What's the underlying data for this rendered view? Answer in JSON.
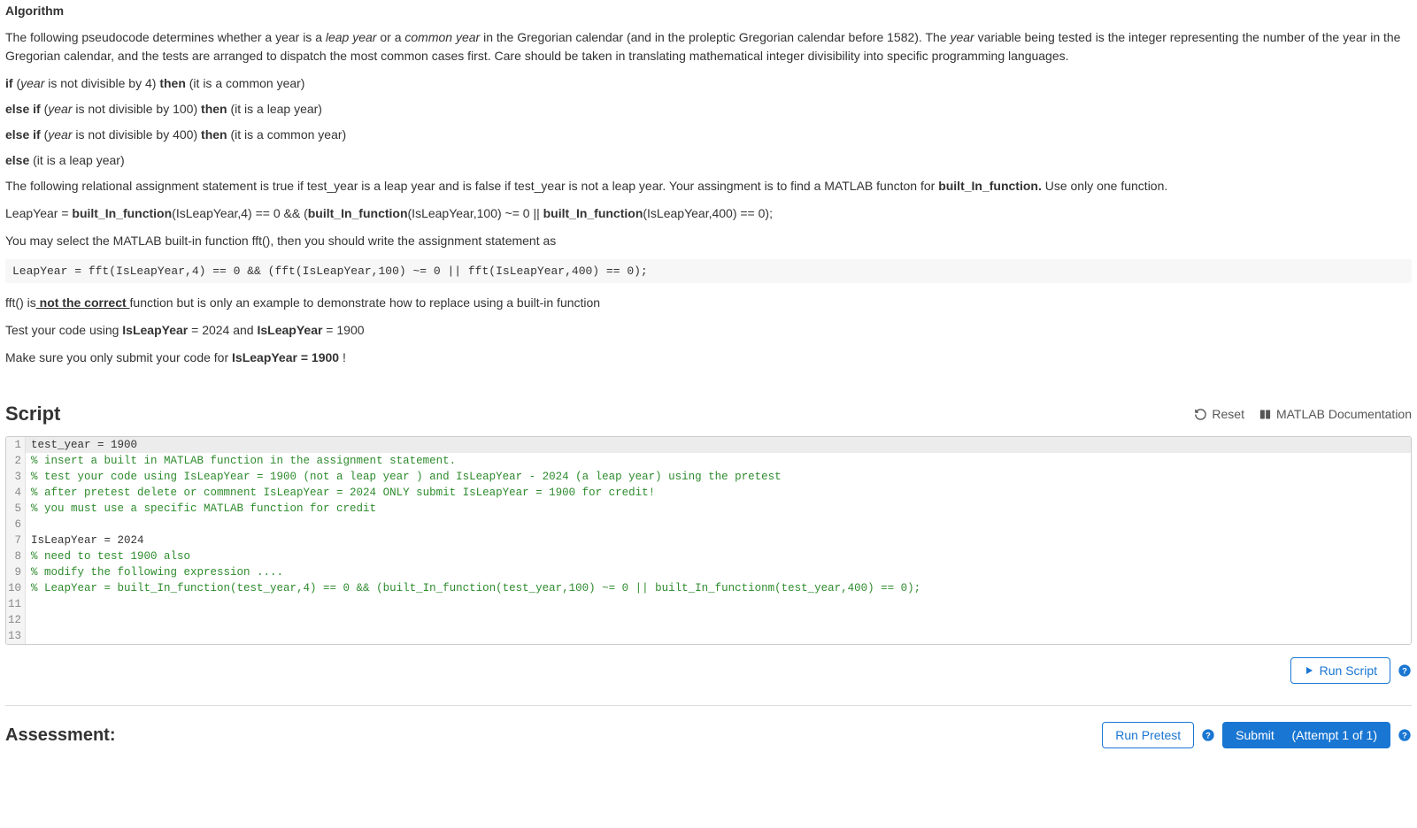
{
  "algorithm": {
    "heading": "Algorithm",
    "intro_pre": "The following pseudocode determines whether a year is a ",
    "leap_italic": "leap year",
    "intro_mid1": " or a ",
    "common_italic": "common year",
    "intro_mid2": " in the Gregorian calendar (and in the proleptic Gregorian calendar before 1582). The ",
    "year_italic": "year",
    "intro_post": " variable being tested is the integer representing the number of the year in the Gregorian calendar, and the tests are arranged to dispatch the most common cases first. Care should be taken in translating mathematical integer divisibility into specific programming languages.",
    "pseudo": {
      "l1_if": "if",
      "l1_open": " (",
      "l1_year": "year",
      "l1_cond": " is not divisible by 4) ",
      "l1_then": "then",
      "l1_result": " (it is a common year)",
      "l2_elseif": "else if",
      "l2_open": " (",
      "l2_year": "year",
      "l2_cond": " is not divisible by 100) ",
      "l2_then": "then",
      "l2_result": " (it is a leap year)",
      "l3_elseif": "else if",
      "l3_open": " (",
      "l3_year": "year",
      "l3_cond": " is not divisible by 400) ",
      "l3_then": "then",
      "l3_result": " (it is a common year)",
      "l4_else": "else",
      "l4_result": " (it is a leap year)"
    },
    "para2_pre": "The following relational assignment statement is true if test_year is a leap year and is false if test_year is not a leap year.  Your assingment is to find a MATLAB functon for ",
    "para2_bold": "built_In_function.",
    "para2_post": "  Use only one function.",
    "stmt_pre": "LeapYear = ",
    "stmt_b1": "built_In_function",
    "stmt_m1": "(IsLeapYear,4) == 0 && (",
    "stmt_b2": "built_In_function",
    "stmt_m2": "(IsLeapYear,100) ~= 0 || ",
    "stmt_b3": "built_In_function",
    "stmt_m3": "(IsLeapYear,400) == 0);",
    "para3": "You may select the MATLAB built-in function fft(), then you should write the assignment statement as",
    "code_fft": "LeapYear = fft(IsLeapYear,4) == 0 && (fft(IsLeapYear,100) ~= 0 || fft(IsLeapYear,400) == 0);",
    "para4_pre": "fft() is",
    "para4_under": " not the correct ",
    "para4_post": "function but is only an example to demonstrate how to replace using a built-in function",
    "para5_pre": "Test your code using ",
    "para5_b1": "IsLeapYear",
    "para5_m1": " = 2024 and ",
    "para5_b2": "IsLeapYear",
    "para5_m2": " = 1900",
    "para6_pre": "Make sure you only submit your code for ",
    "para6_bold": "IsLeapYear = 1900",
    "para6_post": " !"
  },
  "script": {
    "title": "Script",
    "reset_label": "Reset",
    "docs_label": "MATLAB Documentation",
    "lines": [
      {
        "n": "1",
        "active": true,
        "plain": "test_year = 1900",
        "comment": ""
      },
      {
        "n": "2",
        "active": false,
        "plain": "",
        "comment": "% insert a built in MATLAB function in the assignment statement."
      },
      {
        "n": "3",
        "active": false,
        "plain": "",
        "comment": "% test your code using IsLeapYear = 1900 (not a leap year ) and IsLeapYear - 2024 (a leap year) using the pretest"
      },
      {
        "n": "4",
        "active": false,
        "plain": "",
        "comment": "% after pretest delete or commnent IsLeapYear = 2024 ONLY submit IsLeapYear = 1900 for credit!"
      },
      {
        "n": "5",
        "active": false,
        "plain": "",
        "comment": "% you must use a specific MATLAB function for credit"
      },
      {
        "n": "6",
        "active": false,
        "plain": "",
        "comment": ""
      },
      {
        "n": "7",
        "active": false,
        "plain": "IsLeapYear = 2024",
        "comment": ""
      },
      {
        "n": "8",
        "active": false,
        "plain": "",
        "comment": "% need to test 1900 also"
      },
      {
        "n": "9",
        "active": false,
        "plain": "",
        "comment": "% modify the following expression ...."
      },
      {
        "n": "10",
        "active": false,
        "plain": "",
        "comment": "% LeapYear = built_In_function(test_year,4) == 0 && (built_In_function(test_year,100) ~= 0 || built_In_functionm(test_year,400) == 0);"
      },
      {
        "n": "11",
        "active": false,
        "plain": "",
        "comment": ""
      },
      {
        "n": "12",
        "active": false,
        "plain": "",
        "comment": ""
      },
      {
        "n": "13",
        "active": false,
        "plain": "",
        "comment": ""
      }
    ],
    "run_label": "Run Script"
  },
  "assessment": {
    "title": "Assessment:",
    "pretest_label": "Run Pretest",
    "submit_label": "Submit",
    "attempt_label": "(Attempt 1 of 1)"
  }
}
